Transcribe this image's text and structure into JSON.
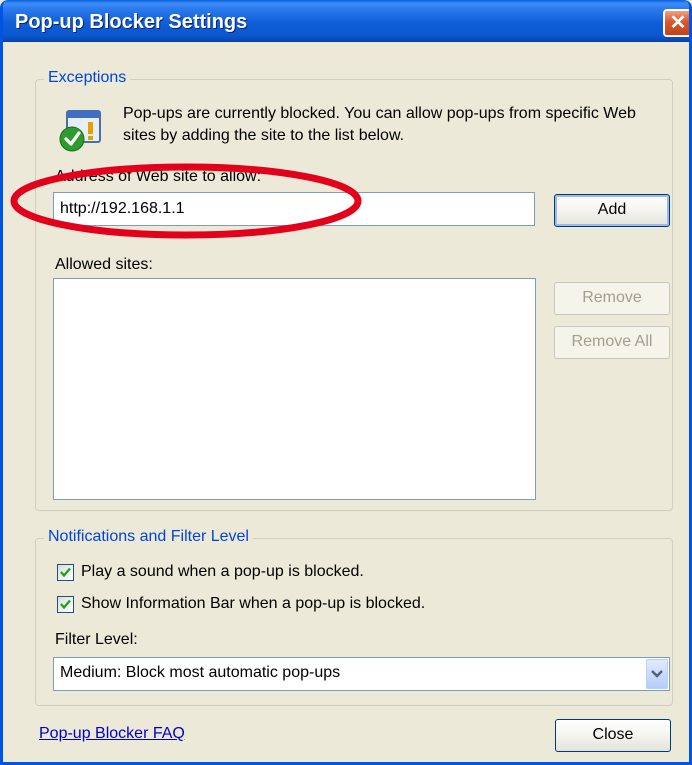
{
  "window": {
    "title": "Pop-up Blocker Settings",
    "close_glyph": "✕"
  },
  "exceptions": {
    "legend": "Exceptions",
    "info_text": "Pop-ups are currently blocked.  You can allow pop-ups from specific Web sites by adding the site to the list below.",
    "address_label": "Address of Web site to allow:",
    "address_value": "http://192.168.1.1",
    "add_label": "Add",
    "allowed_label": "Allowed sites:",
    "allowed_sites": [],
    "remove_label": "Remove",
    "remove_all_label": "Remove All"
  },
  "notifications": {
    "legend": "Notifications and Filter Level",
    "play_sound_label": "Play a sound when a pop-up is blocked.",
    "play_sound_checked": true,
    "show_infobar_label": "Show Information Bar when a pop-up is blocked.",
    "show_infobar_checked": true,
    "filter_label": "Filter Level:",
    "filter_value": "Medium: Block most automatic pop-ups"
  },
  "footer": {
    "faq_link": "Pop-up Blocker FAQ",
    "close_label": "Close"
  },
  "colors": {
    "annotation_ellipse": "#E3001B",
    "title_bar": "#0A57D0",
    "legend_text": "#0046D5"
  },
  "icons": [
    "info-shield-icon",
    "checkmark-icon",
    "dropdown-arrow-icon",
    "close-icon"
  ]
}
